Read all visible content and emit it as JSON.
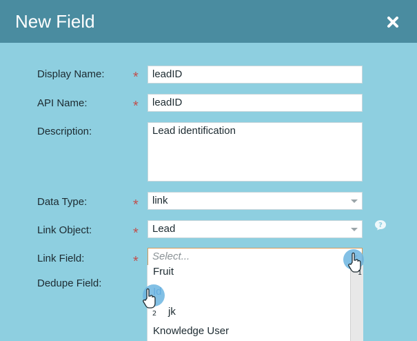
{
  "dialog": {
    "title": "New Field"
  },
  "form": {
    "display_name_label": "Display Name:",
    "display_name_value": "leadID",
    "api_name_label": "API Name:",
    "api_name_value": "leadID",
    "description_label": "Description:",
    "description_value": "Lead identification",
    "data_type_label": "Data Type:",
    "data_type_value": "link",
    "link_object_label": "Link Object:",
    "link_object_value": "Lead",
    "link_field_label": "Link Field:",
    "link_field_placeholder": "Select...",
    "dedupe_field_label": "Dedupe Field:",
    "required_mark": "*"
  },
  "dropdown": {
    "options": [
      {
        "label": "Fruit"
      },
      {
        "label": "Id"
      },
      {
        "label": "jk"
      },
      {
        "label": "Knowledge User"
      }
    ]
  },
  "annotations": {
    "step1": "1",
    "step2": "2"
  },
  "colors": {
    "header": "#4a8ca0",
    "background": "#8ecfe0",
    "required": "#c0504d",
    "link_text": "#3a7bd5"
  }
}
